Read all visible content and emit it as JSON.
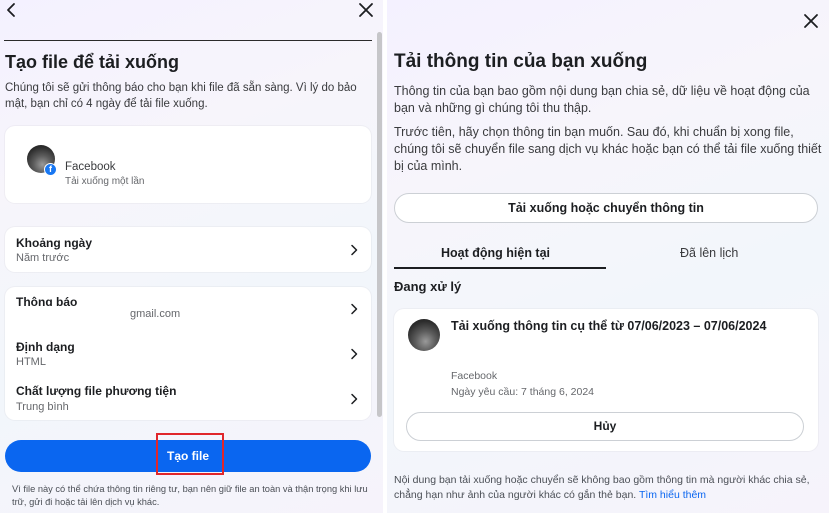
{
  "left": {
    "title": "Tạo file để tải xuống",
    "description": "Chúng tôi sẽ gửi thông báo cho bạn khi file đã sẵn sàng. Vì lý do bảo mật, bạn chỉ có 4 ngày để tải file xuống.",
    "profile": {
      "name": "Facebook",
      "subtitle": "Tải xuống một lần",
      "badge": "f"
    },
    "rows": {
      "date_range": {
        "label": "Khoảng ngày",
        "value": "Năm trước"
      },
      "notification": {
        "label": "Thông báo",
        "value": "gmail.com"
      },
      "format": {
        "label": "Định dạng",
        "value": "HTML"
      },
      "media_quality": {
        "label": "Chất lượng file phương tiện",
        "value": "Trung bình"
      }
    },
    "create_button": "Tạo file",
    "footer_note": "Vì file này có thể chứa thông tin riêng tư, bạn nên giữ file an toàn và thận trọng khi lưu trữ, gửi đi hoặc tải lên dịch vụ khác."
  },
  "right": {
    "title": "Tải thông tin của bạn xuống",
    "paragraph1": "Thông tin của bạn bao gồm nội dung bạn chia sẻ, dữ liệu về hoạt động của bạn và những gì chúng tôi thu thập.",
    "paragraph2": "Trước tiên, hãy chọn thông tin bạn muốn. Sau đó, khi chuẩn bị xong file, chúng tôi sẽ chuyển file sang dịch vụ khác hoặc bạn có thể tải file xuống thiết bị của mình.",
    "download_button": "Tải xuống hoặc chuyển thông tin",
    "tabs": [
      "Hoạt động hiện tại",
      "Đã lên lịch"
    ],
    "section_title": "Đang xử lý",
    "request": {
      "title": "Tải xuống thông tin cụ thể từ 07/06/2023 – 07/06/2024",
      "source": "Facebook",
      "date": "Ngày yêu cầu: 7 tháng 6, 2024",
      "cancel_button": "Hủy"
    },
    "footer_note": "Nội dung bạn tải xuống hoặc chuyển sẽ không bao gồm thông tin mà người khác chia sẻ, chẳng hạn như ảnh của người khác có gắn thẻ bạn.",
    "footer_link": "Tìm hiểu thêm"
  },
  "colors": {
    "primary": "#0a66f0",
    "highlight": "#e0262b",
    "facebook": "#1877f2"
  },
  "icons": [
    "back-arrow-icon",
    "close-icon",
    "chevron-right-icon",
    "facebook-icon"
  ]
}
